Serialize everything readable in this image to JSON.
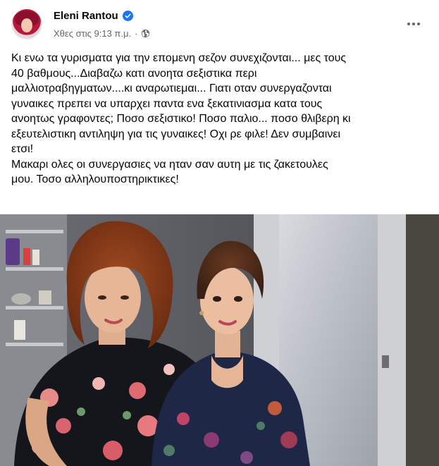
{
  "post": {
    "author": "Eleni Rantou",
    "verified": true,
    "timestamp": "Χθες στις 9:13 π.μ.",
    "separator": "·",
    "privacy_icon": "globe-icon",
    "more_icon": "more-options-icon",
    "text_lines": [
      "Κι ενω τα γυρισματα για την επομενη σεζον συνεχιζονται... μες τους",
      "40 βαθμους...Διαβαζω κατι ανοητα σεξιστικα περι",
      "μαλλιοτραβηγματων....κι αναρωτιεμαι... Γιατι οταν συνεργαζονται",
      "γυναικες πρεπει να υπαρχει παντα  ενα ξεκατινιασμα κατα τους",
      "ανοητως γραφοντες;  Ποσο σεξιστικο! Ποσο παλιο... ποσο θλιβερη κι",
      "εξευτελιστικη αντιληψη για τις γυναικες!  Οχι ρε φιλε! Δεν συμβαινει",
      "ετσι!",
      "Μακαρι ολες οι συνεργασιες να ηταν σαν  αυτη με τις ζακετουλες",
      "μου. Τοσο αλληλουποστηρικτικες!"
    ]
  },
  "colors": {
    "verified_blue": "#1877f2",
    "secondary_text": "#65676b",
    "primary_text": "#050505"
  }
}
